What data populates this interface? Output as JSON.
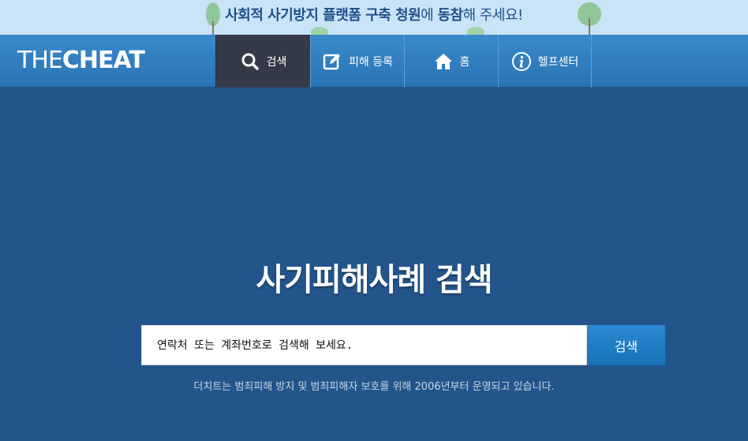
{
  "banner": {
    "part1": "사회적 사기방지 플랫폼 구축 청원",
    "part2": "에 ",
    "part3": "동참",
    "part4": "해 주세요!"
  },
  "logo": {
    "thin": "THE",
    "bold": "CHEAT"
  },
  "nav": {
    "items": [
      {
        "label": "검색",
        "icon": "search-icon",
        "active": true
      },
      {
        "label": "피해 등록",
        "icon": "edit-icon",
        "active": false
      },
      {
        "label": "홈",
        "icon": "home-icon",
        "active": false
      },
      {
        "label": "헬프센터",
        "icon": "info-icon",
        "active": false
      }
    ]
  },
  "main": {
    "title": "사기피해사례 검색",
    "search_placeholder": "연락처 또는 계좌번호로 검색해 보세요.",
    "search_button": "검색",
    "footnote": "더치트는 범죄피해 방지 및 범죄피해자 보호를 위해 2006년부터 운영되고 있습니다."
  },
  "colors": {
    "background": "#23558c",
    "nav": "#2f7dc0",
    "nav_active": "#353a48",
    "banner": "#c9e4f6",
    "button": "#1d7ec6"
  }
}
